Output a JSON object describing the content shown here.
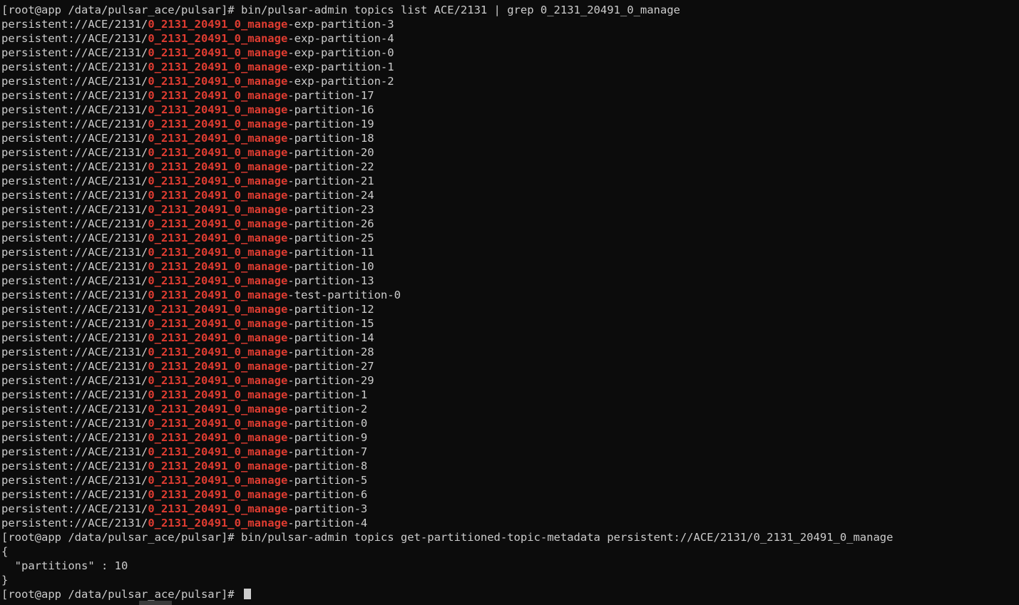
{
  "terminal": {
    "prompt": "[root@app /data/pulsar_ace/pulsar]# ",
    "command1": "bin/pulsar-admin topics list ACE/2131 | grep 0_2131_20491_0_manage",
    "topic_prefix": "persistent://ACE/2131/",
    "match_text": "0_2131_20491_0_manage",
    "suffixes": [
      "-exp-partition-3",
      "-exp-partition-4",
      "-exp-partition-0",
      "-exp-partition-1",
      "-exp-partition-2",
      "-partition-17",
      "-partition-16",
      "-partition-19",
      "-partition-18",
      "-partition-20",
      "-partition-22",
      "-partition-21",
      "-partition-24",
      "-partition-23",
      "-partition-26",
      "-partition-25",
      "-partition-11",
      "-partition-10",
      "-partition-13",
      "-test-partition-0",
      "-partition-12",
      "-partition-15",
      "-partition-14",
      "-partition-28",
      "-partition-27",
      "-partition-29",
      "-partition-1",
      "-partition-2",
      "-partition-0",
      "-partition-9",
      "-partition-7",
      "-partition-8",
      "-partition-5",
      "-partition-6",
      "-partition-3",
      "-partition-4"
    ],
    "command2": "bin/pulsar-admin topics get-partitioned-topic-metadata persistent://ACE/2131/0_2131_20491_0_manage",
    "json_lines": [
      "{",
      "  \"partitions\" : 10",
      "}"
    ],
    "colors": {
      "background": "#0c0c0c",
      "text": "#cccccc",
      "match": "#e03c31"
    }
  }
}
